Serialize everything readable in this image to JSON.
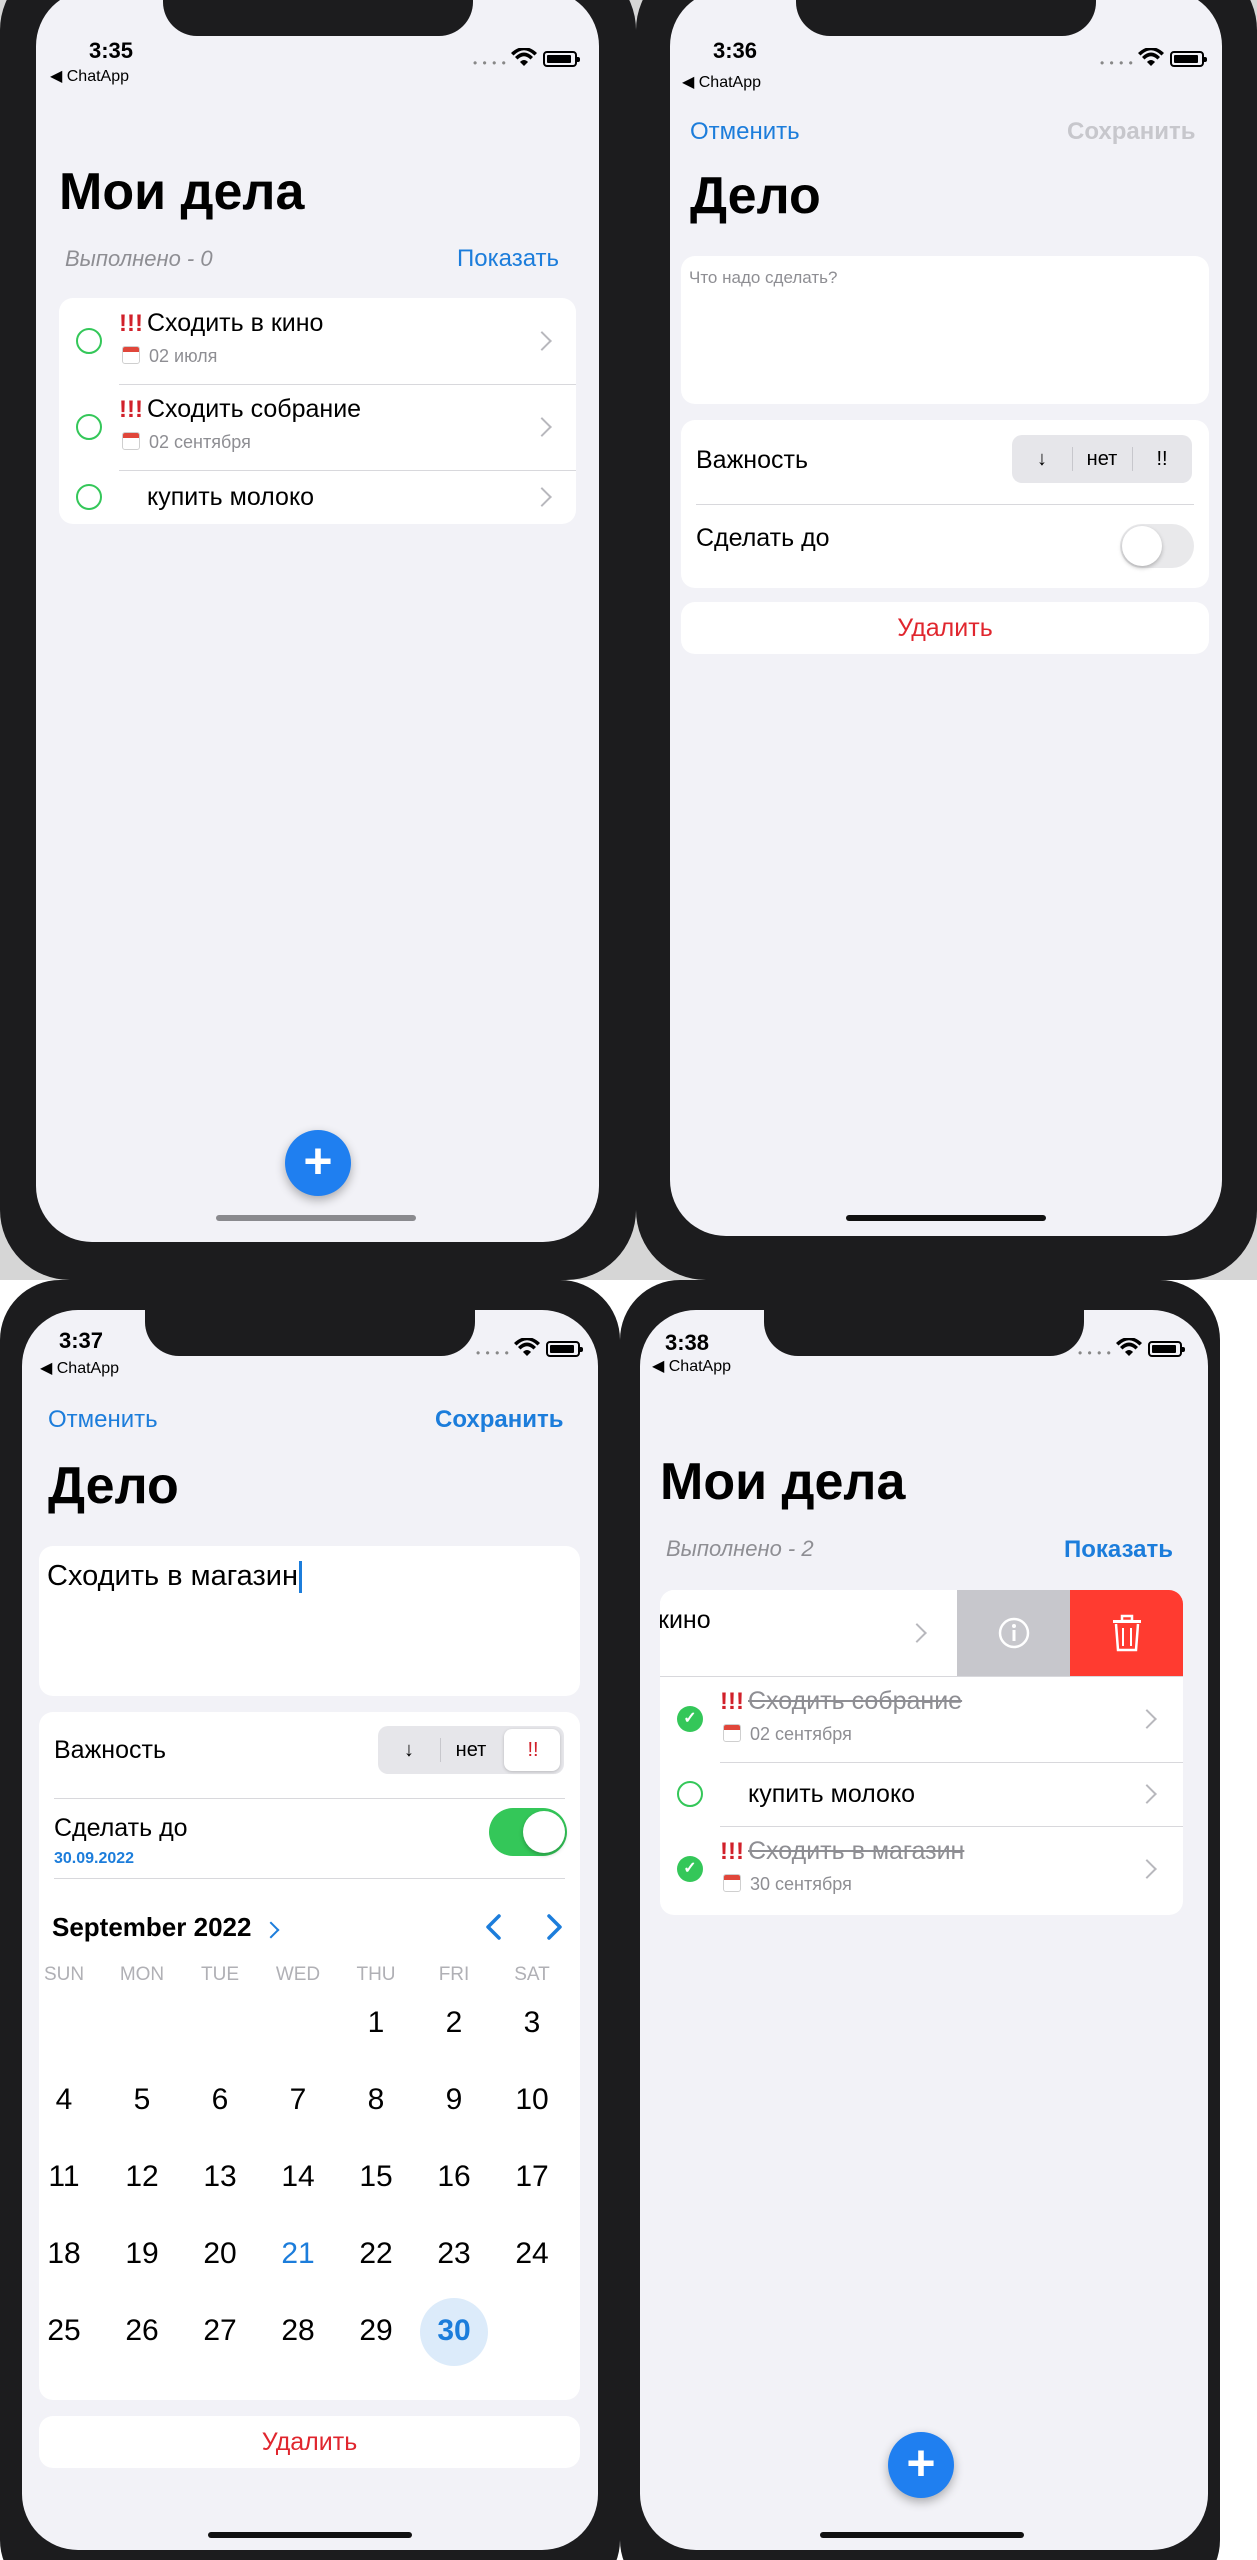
{
  "screens": {
    "s1": {
      "time": "3:35",
      "back": "◀ ChatApp",
      "title": "Мои дела",
      "done_count": "Выполнено - 0",
      "show_label": "Показать",
      "tasks": [
        {
          "priority": "!!!",
          "title": "Сходить в кино",
          "date": "02 июля"
        },
        {
          "priority": "!!!",
          "title": "Сходить собрание",
          "date": "02 сентября"
        },
        {
          "title": "купить молоко"
        }
      ],
      "fab": "+"
    },
    "s2": {
      "time": "3:36",
      "back": "◀ ChatApp",
      "cancel": "Отменить",
      "save": "Сохранить",
      "title": "Дело",
      "placeholder": "Что надо сделать?",
      "importance_label": "Важность",
      "importance_options": [
        "↓",
        "нет",
        "!!"
      ],
      "deadline_label": "Сделать до",
      "delete": "Удалить"
    },
    "s3": {
      "time": "3:37",
      "back": "◀ ChatApp",
      "cancel": "Отменить",
      "save": "Сохранить",
      "title": "Дело",
      "text": "Сходить в магазин",
      "importance_label": "Важность",
      "importance_options": [
        "↓",
        "нет",
        "!!"
      ],
      "deadline_label": "Сделать до",
      "deadline_date": "30.09.2022",
      "month": "September 2022",
      "weekdays": [
        "SUN",
        "MON",
        "TUE",
        "WED",
        "THU",
        "FRI",
        "SAT"
      ],
      "days": [
        "1",
        "2",
        "3",
        "4",
        "5",
        "6",
        "7",
        "8",
        "9",
        "10",
        "11",
        "12",
        "13",
        "14",
        "15",
        "16",
        "17",
        "18",
        "19",
        "20",
        "21",
        "22",
        "23",
        "24",
        "25",
        "26",
        "27",
        "28",
        "29",
        "30"
      ],
      "delete": "Удалить"
    },
    "s4": {
      "time": "3:38",
      "back": "◀ ChatApp",
      "title": "Мои дела",
      "done_count": "Выполнено - 2",
      "show_label": "Показать",
      "swiped_task": "кино",
      "tasks": [
        {
          "priority": "!!!",
          "title": "Сходить собрание",
          "date": "02 сентября"
        },
        {
          "title": "купить молоко"
        },
        {
          "priority": "!!!",
          "title": "Сходить в магазин",
          "date": "30 сентября"
        }
      ],
      "fab": "+"
    }
  },
  "colors": {
    "accent": "#1c7ddb",
    "green": "#34c759",
    "red": "#d1202a",
    "bg": "#f2f2f7"
  }
}
